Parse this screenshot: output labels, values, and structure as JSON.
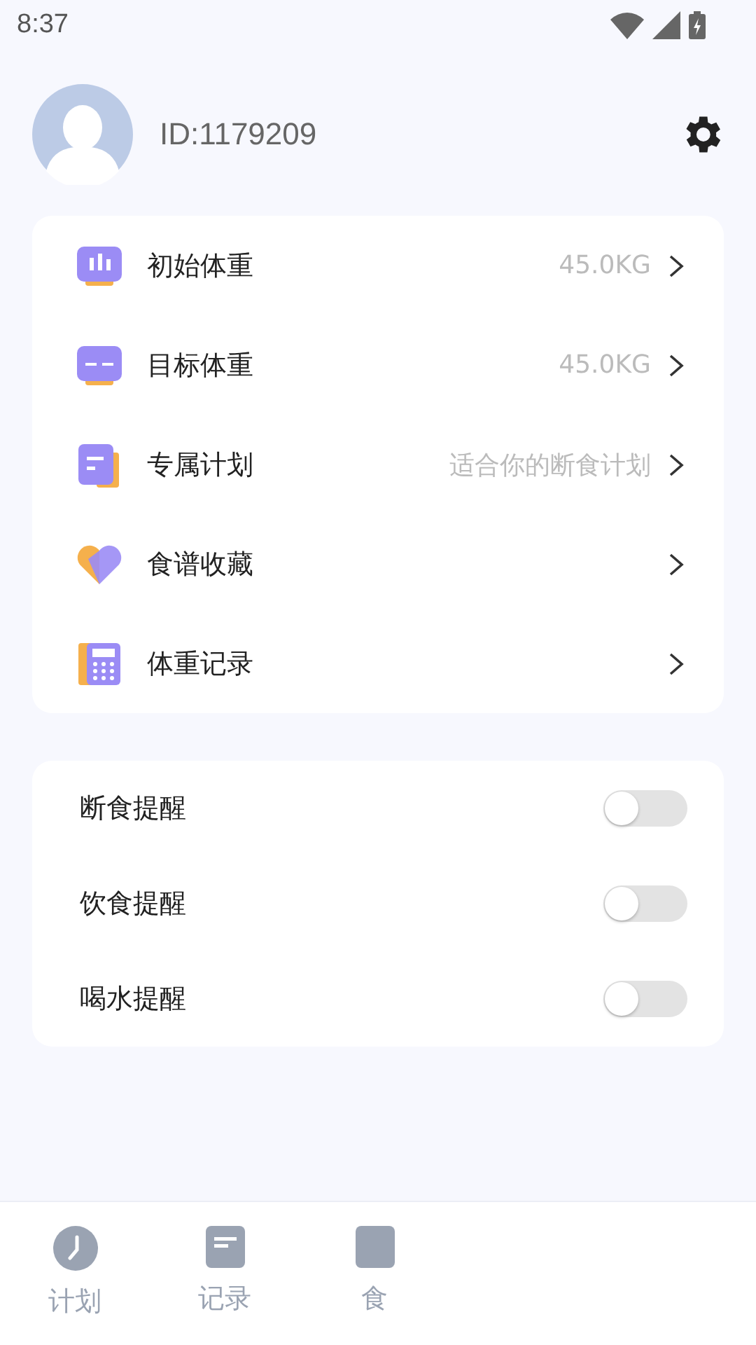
{
  "status_bar": {
    "time": "8:37"
  },
  "profile": {
    "user_id": "ID:1179209"
  },
  "menu": [
    {
      "label": "初始体重",
      "value": "45.0KG"
    },
    {
      "label": "目标体重",
      "value": "45.0KG"
    },
    {
      "label": "专属计划",
      "value": "适合你的断食计划"
    },
    {
      "label": "食谱收藏"
    },
    {
      "label": "体重记录"
    }
  ],
  "reminders": [
    {
      "label": "断食提醒",
      "on": false
    },
    {
      "label": "饮食提醒",
      "on": false
    },
    {
      "label": "喝水提醒",
      "on": false
    }
  ],
  "bottom_nav": [
    {
      "label": "计划"
    },
    {
      "label": "记录"
    },
    {
      "label": "食"
    }
  ]
}
